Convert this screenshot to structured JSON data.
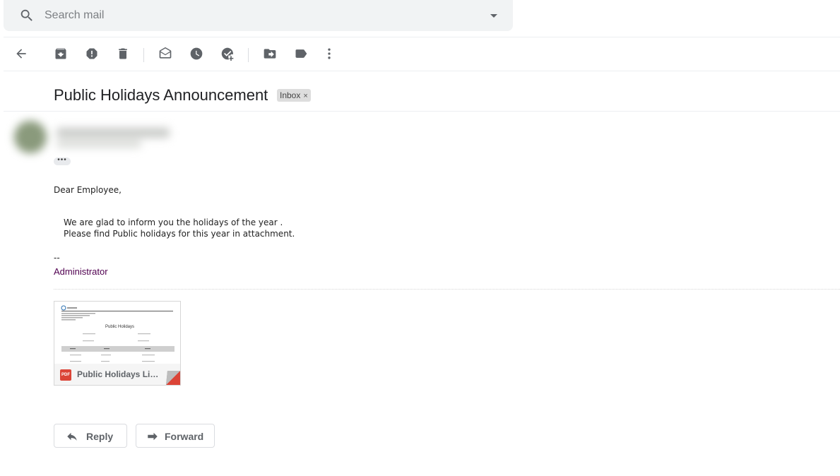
{
  "search": {
    "placeholder": "Search mail"
  },
  "toolbar": {
    "icons": [
      "back-icon",
      "archive-icon",
      "report-spam-icon",
      "delete-icon",
      "mark-unread-icon",
      "snooze-icon",
      "add-to-tasks-icon",
      "move-to-icon",
      "labels-icon",
      "more-icon"
    ]
  },
  "email": {
    "subject": "Public Holidays Announcement",
    "label": "Inbox",
    "label_remove": "×",
    "show_trimmed": "•••",
    "greeting": "Dear Employee,",
    "body_line1": "We are glad to inform you the holidays of the year .",
    "body_line2": "Please find Public holidays for this year in attachment.",
    "sig_separator": "--",
    "signature": "Administrator"
  },
  "attachment": {
    "type_label": "PDF",
    "name": "Public Holidays List.pdf",
    "preview_title": "Public Holidays",
    "brand_color": "#db4437"
  },
  "actions": {
    "reply": "Reply",
    "forward": "Forward"
  }
}
